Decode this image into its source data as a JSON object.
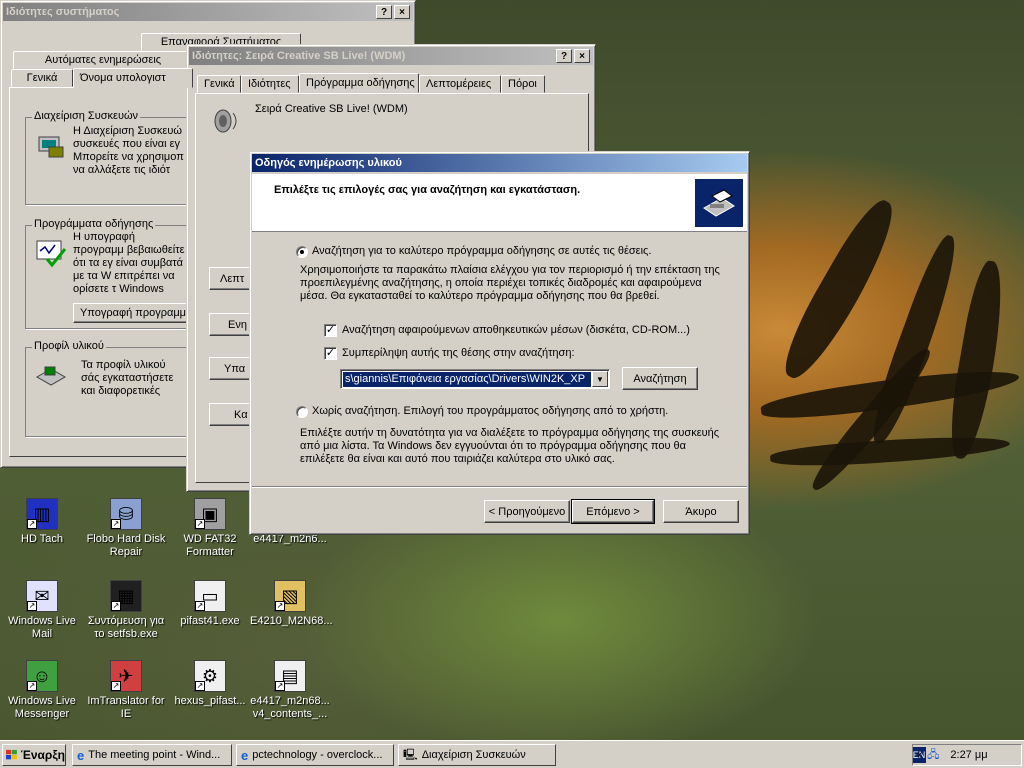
{
  "colors": {
    "active_title": "#0a246a",
    "inactive_title": "#808080",
    "face": "#d4d0c8",
    "selection": "#0a246a"
  },
  "sysprops": {
    "title": "Ιδιότητες συστήματος",
    "tabs_row1": [
      "Επαναφορά Συστήματος"
    ],
    "tabs_row2": [
      "Αυτόματες ενημερώσεις"
    ],
    "tabs_row3": [
      "Γενικά",
      "Όνομα υπολογιστ"
    ],
    "devmgr_legend": "Διαχείριση Συσκευών",
    "devmgr_text": "Η Διαχείριση Συσκευώ συσκευές που είναι εγ Μπορείτε να χρησιμοπ να αλλάξετε τις ιδιότ",
    "drivers_legend": "Προγράμματα οδήγησης",
    "drivers_text": "Η υπογραφή προγραμμ βεβαιωθείτε ότι τα εγ είναι συμβατά με τα W επιτρέπει να ορίσετε τ Windows Update για πρ",
    "sign_button": "Υπογραφή προγραμμ",
    "profiles_legend": "Προφίλ υλικού",
    "profiles_text": "Τα προφίλ υλικού σάς εγκαταστήσετε και διαφορετικές διαμορ"
  },
  "sbprops": {
    "title": "Ιδιότητες: Σειρά Creative SB Live! (WDM)",
    "tabs": [
      "Γενικά",
      "Ιδιότητες",
      "Πρόγραμμα οδήγησης",
      "Λεπτομέρειες",
      "Πόροι"
    ],
    "device_name": "Σειρά Creative SB Live! (WDM)",
    "side_buttons": [
      "Λεπτ",
      "Ενη",
      "Υπα",
      "Κα"
    ]
  },
  "wizard": {
    "title": "Οδηγός ενημέρωσης υλικού",
    "header": "Επιλέξτε τις επιλογές σας για αναζήτηση και εγκατάσταση.",
    "option1": "Αναζήτηση για το καλύτερο πρόγραμμα οδήγησης σε αυτές τις θέσεις.",
    "option1_desc": "Χρησιμοποιήστε τα παρακάτω πλαίσια ελέγχου για τον περιορισμό ή την επέκταση της προεπιλεγμένης αναζήτησης, η οποία περιέχει τοπικές διαδρομές και αφαιρούμενα μέσα. Θα εγκατασταθεί το καλύτερο πρόγραμμα οδήγησης που θα βρεθεί.",
    "check1": "Αναζήτηση αφαιρούμενων αποθηκευτικών μέσων (δισκέτα, CD-ROM...)",
    "check2": "Συμπερίληψη αυτής της θέσης στην αναζήτηση:",
    "path_value": "s\\giannis\\Επιφάνεια εργασίας\\Drivers\\WIN2K_XP",
    "browse_button": "Αναζήτηση",
    "option2": "Χωρίς αναζήτηση. Επιλογή του προγράμματος οδήγησης από το χρήστη.",
    "option2_desc": "Επιλέξτε αυτήν τη δυνατότητα για να διαλέξετε το πρόγραμμα οδήγησης της συσκευής από μια λίστα. Τα Windows δεν εγγυούνται ότι το πρόγραμμα οδήγησης που θα επιλέξετε θα είναι και αυτό που ταιριάζει καλύτερα στο υλικό σας.",
    "back_button": "< Προηγούμενο",
    "next_button": "Επόμενο >",
    "cancel_button": "Άκυρο",
    "help_button": "?",
    "close_button": "×"
  },
  "desktop_icons": [
    {
      "label": "HD Tach",
      "icon": "hdtach-icon"
    },
    {
      "label": "Flobo Hard Disk Repair",
      "icon": "disk-repair-icon"
    },
    {
      "label": "WD FAT32 Formatter",
      "icon": "formatter-icon"
    },
    {
      "label": "e4417_m2n6...",
      "icon": "file-icon"
    },
    {
      "label": "Windows Live Mail",
      "icon": "mail-icon"
    },
    {
      "label": "Συντόμευση για το setfsb.exe",
      "icon": "pll-icon"
    },
    {
      "label": "pifast41.exe",
      "icon": "exe-icon"
    },
    {
      "label": "E4210_M2N68...",
      "icon": "folder-doc-icon"
    },
    {
      "label": "Windows Live Messenger",
      "icon": "messenger-icon"
    },
    {
      "label": "ImTranslator for IE",
      "icon": "translator-icon"
    },
    {
      "label": "hexus_pifast...",
      "icon": "gear-exe-icon"
    },
    {
      "label": "e4417_m2n68... v4_contents_...",
      "icon": "pdf-icon"
    }
  ],
  "taskbar": {
    "start": "Έναρξη",
    "tasks": [
      "The meeting point - Wind...",
      "pctechnology - overclock...",
      "Διαχείριση Συσκευών"
    ],
    "lang": "EN",
    "clock": "2:27 μμ"
  }
}
